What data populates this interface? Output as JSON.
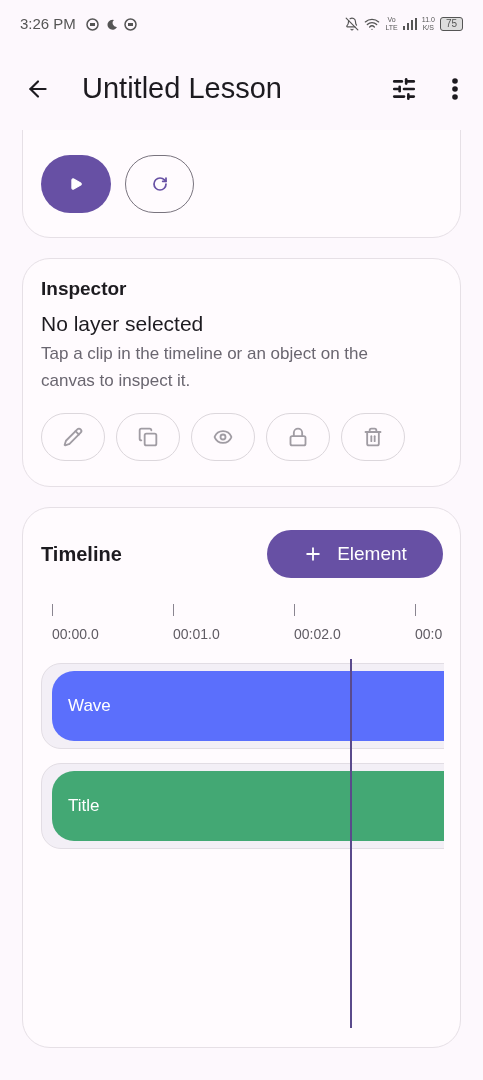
{
  "status_bar": {
    "time": "3:26 PM",
    "network_type": "Vo\nLTE",
    "speed": "11.0\nK/S",
    "battery": "75"
  },
  "app_bar": {
    "title": "Untitled Lesson"
  },
  "playback": {
    "playing": false
  },
  "inspector": {
    "heading": "Inspector",
    "title": "No layer selected",
    "description": "Tap a clip in the timeline or an object on the canvas to inspect it.",
    "actions": [
      {
        "kind": "edit",
        "disabled": true
      },
      {
        "kind": "duplicate",
        "disabled": true
      },
      {
        "kind": "visibility",
        "disabled": true
      },
      {
        "kind": "lock",
        "disabled": true
      },
      {
        "kind": "delete",
        "disabled": true
      }
    ]
  },
  "timeline": {
    "heading": "Timeline",
    "add_button": "Element",
    "ticks": [
      "00:00.0",
      "00:01.0",
      "00:02.0",
      "00:0"
    ],
    "clips": [
      {
        "label": "Wave",
        "color": "#5b6ffc"
      },
      {
        "label": "Title",
        "color": "#43a874"
      }
    ]
  }
}
